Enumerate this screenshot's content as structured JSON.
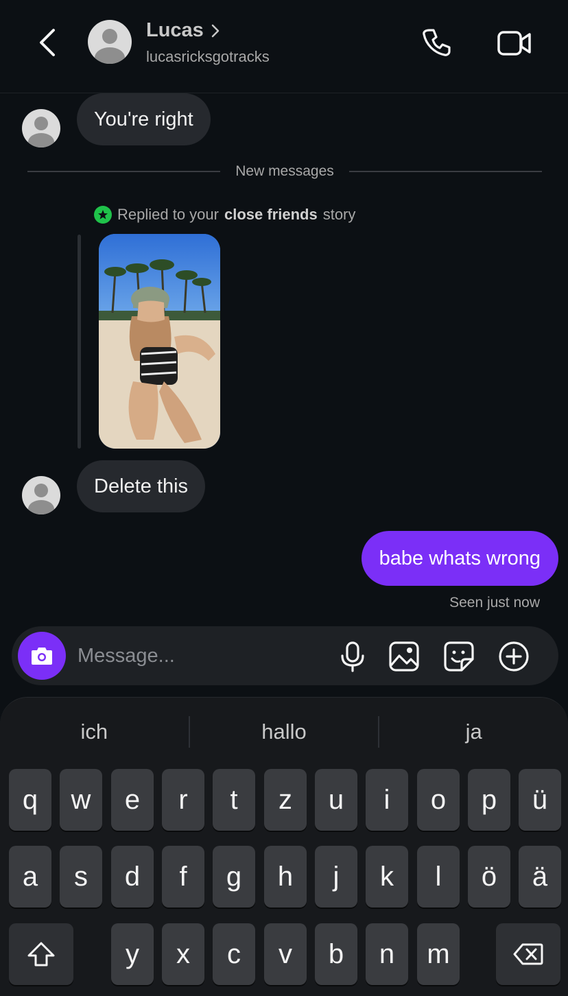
{
  "header": {
    "name": "Lucas",
    "username": "lucasricksgotracks"
  },
  "messages": {
    "first": "You're right",
    "divider": "New messages",
    "story_caption_prefix": "Replied to your",
    "story_caption_bold": "close friends",
    "story_caption_suffix": "story",
    "second": "Delete this",
    "outgoing": "babe whats wrong",
    "seen": "Seen just now"
  },
  "composer": {
    "placeholder": "Message..."
  },
  "keyboard": {
    "suggestions": [
      "ich",
      "hallo",
      "ja"
    ],
    "row1": [
      "q",
      "w",
      "e",
      "r",
      "t",
      "z",
      "u",
      "i",
      "o",
      "p",
      "ü"
    ],
    "row2": [
      "a",
      "s",
      "d",
      "f",
      "g",
      "h",
      "j",
      "k",
      "l",
      "ö",
      "ä"
    ],
    "row3": [
      "y",
      "x",
      "c",
      "v",
      "b",
      "n",
      "m"
    ]
  },
  "colors": {
    "accent": "#7b2ff7",
    "background": "#0c1014",
    "close_friends": "#1fc24a"
  }
}
